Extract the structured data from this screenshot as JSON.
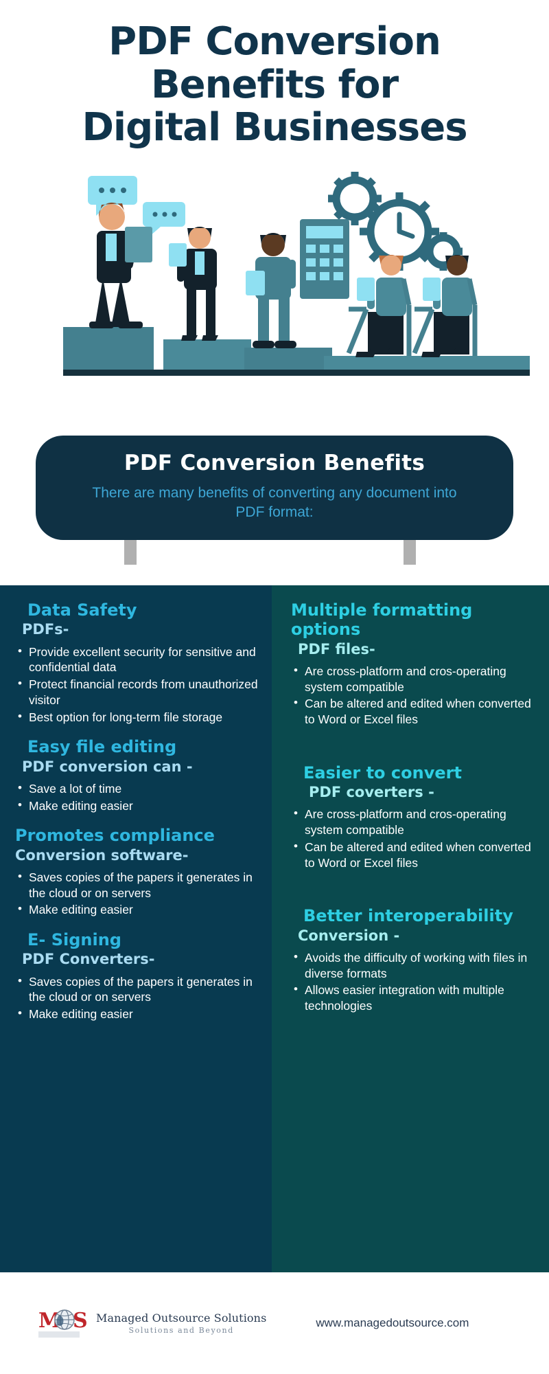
{
  "header": {
    "title_lines": [
      "PDF Conversion",
      "Benefits for",
      "Digital Businesses"
    ],
    "title_full": "PDF Conversion Benefits for Digital Businesses"
  },
  "banner": {
    "title": "PDF Conversion Benefits",
    "subtitle": "There are many benefits of converting any document into PDF format:"
  },
  "left_column": {
    "sections": [
      {
        "title": "Data Safety",
        "subtitle": "PDFs-",
        "bullets": [
          "Provide excellent security for sensitive and confidential data",
          "Protect financial records from unauthorized visitor",
          "Best option for long-term file storage"
        ]
      },
      {
        "title": "Easy file editing",
        "subtitle": "PDF conversion can -",
        "bullets": [
          "Save a lot of time",
          "Make editing easier"
        ]
      },
      {
        "title": "Promotes compliance",
        "subtitle": "Conversion software-",
        "bullets": [
          "Saves copies of the papers it generates in the cloud or on servers",
          "Make editing easier"
        ]
      },
      {
        "title": "E- Signing",
        "subtitle": "PDF Converters-",
        "bullets": [
          "Saves copies of the papers it generates in the cloud or on servers",
          "Make editing easier"
        ]
      }
    ]
  },
  "right_column": {
    "sections": [
      {
        "title": "Multiple formatting options",
        "subtitle": "PDF files-",
        "bullets": [
          "Are cross-platform and cros-operating system compatible",
          "Can be altered and edited when converted to Word or Excel files"
        ]
      },
      {
        "title": "Easier to convert",
        "subtitle": "PDF coverters -",
        "bullets": [
          "Are cross-platform and cros-operating system compatible",
          "Can be altered and edited when converted to Word or Excel files"
        ]
      },
      {
        "title": "Better interoperability",
        "subtitle": "Conversion -",
        "bullets": [
          "Avoids the difficulty of working with files in diverse formats",
          "Allows easier integration with multiple technologies"
        ]
      }
    ]
  },
  "footer": {
    "logo_letters": "M S",
    "brand_name": "Managed Outsource Solutions",
    "brand_tagline": "Solutions and Beyond",
    "website": "www.managedoutsource.com"
  },
  "colors": {
    "title_navy": "#10344b",
    "banner_bg": "#0f3144",
    "banner_sub": "#3ea7d6",
    "left_bg": "#083a50",
    "right_bg": "#0a4a4e",
    "heading_blue": "#2fb7e0",
    "heading_teal": "#2ecfe3",
    "sub_lightblue": "#aadcf2",
    "sub_lightteal": "#a6eef0",
    "body_text": "#ffffff",
    "illustration_teal": "#44808f",
    "illustration_lightblue": "#8fe0f2",
    "illustration_dark": "#13212b",
    "leg_gray": "#b0b0b0",
    "logo_red": "#c0262b"
  }
}
